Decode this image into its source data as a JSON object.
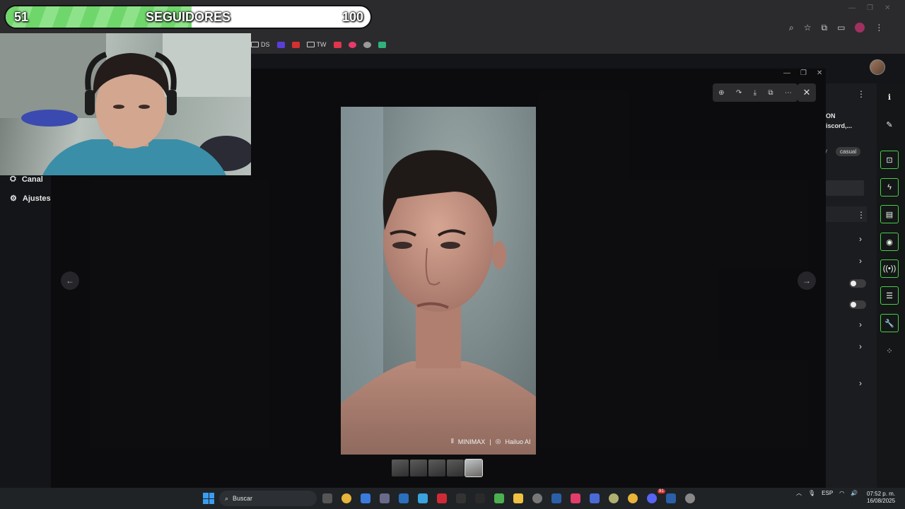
{
  "follower_goal": {
    "current": "51",
    "label": "SEGUIDORES",
    "target": "100",
    "progress_fraction": 0.51
  },
  "bookmarks": [
    {
      "label": "DS",
      "icon": "folder-icon"
    },
    {
      "label": "",
      "icon": "purple-app-icon",
      "color": "#5a3ed8"
    },
    {
      "label": "",
      "icon": "red-app-icon",
      "color": "#d33030"
    },
    {
      "label": "TW",
      "icon": "folder-icon"
    },
    {
      "label": "",
      "icon": "red-app-icon",
      "color": "#e0354a"
    },
    {
      "label": "",
      "icon": "pink-app-icon",
      "color": "#e83a6a"
    },
    {
      "label": "",
      "icon": "gray-app-icon",
      "color": "#9a9a9a"
    },
    {
      "label": "",
      "icon": "green-app-icon",
      "color": "#2fb37a"
    }
  ],
  "left_nav": {
    "items": [
      {
        "label": "Canal",
        "icon": "channel-icon"
      },
      {
        "label": "Ajustes",
        "icon": "gear-icon"
      }
    ]
  },
  "right_panel": {
    "header_line1": "ON",
    "header_line2": "iscord,...",
    "tag_partial": "y",
    "tag": "casual"
  },
  "viewer": {
    "watermark_brand1": "MINIMAX",
    "watermark_sep": "|",
    "watermark_brand2": "Hailuo AI"
  },
  "taskbar": {
    "search_placeholder": "Buscar",
    "language": "ESP",
    "time": "07:52 p. m.",
    "date": "16/08/2025",
    "notification_badge": "91"
  },
  "colors": {
    "accent_green": "#46d046",
    "bar_fill": "#6fd66b",
    "windows_blue": "#3b9cf0"
  }
}
